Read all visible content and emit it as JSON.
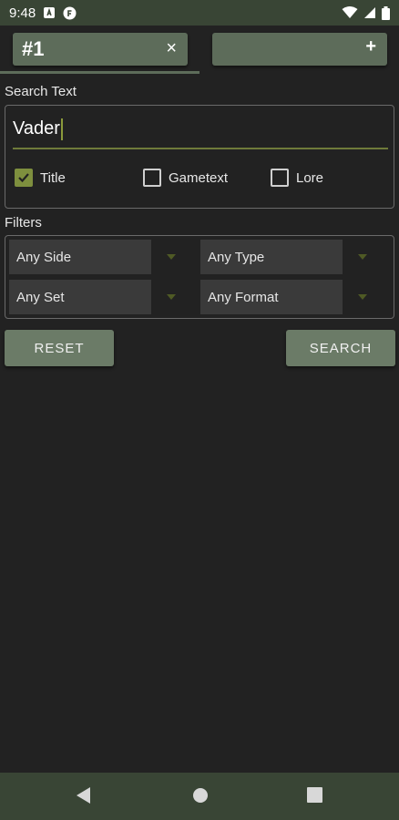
{
  "status_bar": {
    "time": "9:48",
    "icons": [
      "notification-a-icon",
      "notification-f-icon",
      "wifi-icon",
      "signal-icon",
      "battery-icon"
    ]
  },
  "tabs": [
    {
      "title": "#1",
      "action": "×"
    },
    {
      "title": "",
      "action": "+"
    }
  ],
  "search": {
    "section_label": "Search Text",
    "value": "Vader",
    "options": [
      {
        "label": "Title",
        "checked": true
      },
      {
        "label": "Gametext",
        "checked": false
      },
      {
        "label": "Lore",
        "checked": false
      }
    ]
  },
  "filters": {
    "section_label": "Filters",
    "side": "Any Side",
    "type": "Any Type",
    "set": "Any Set",
    "format": "Any Format"
  },
  "buttons": {
    "reset": "RESET",
    "search": "SEARCH"
  },
  "nav": [
    "back-icon",
    "home-icon",
    "recents-icon"
  ],
  "colors": {
    "background": "#222222",
    "bar": "#394535",
    "accent": "#7e8f3e",
    "button": "#6b7b67",
    "tab": "#5d6c5a"
  }
}
